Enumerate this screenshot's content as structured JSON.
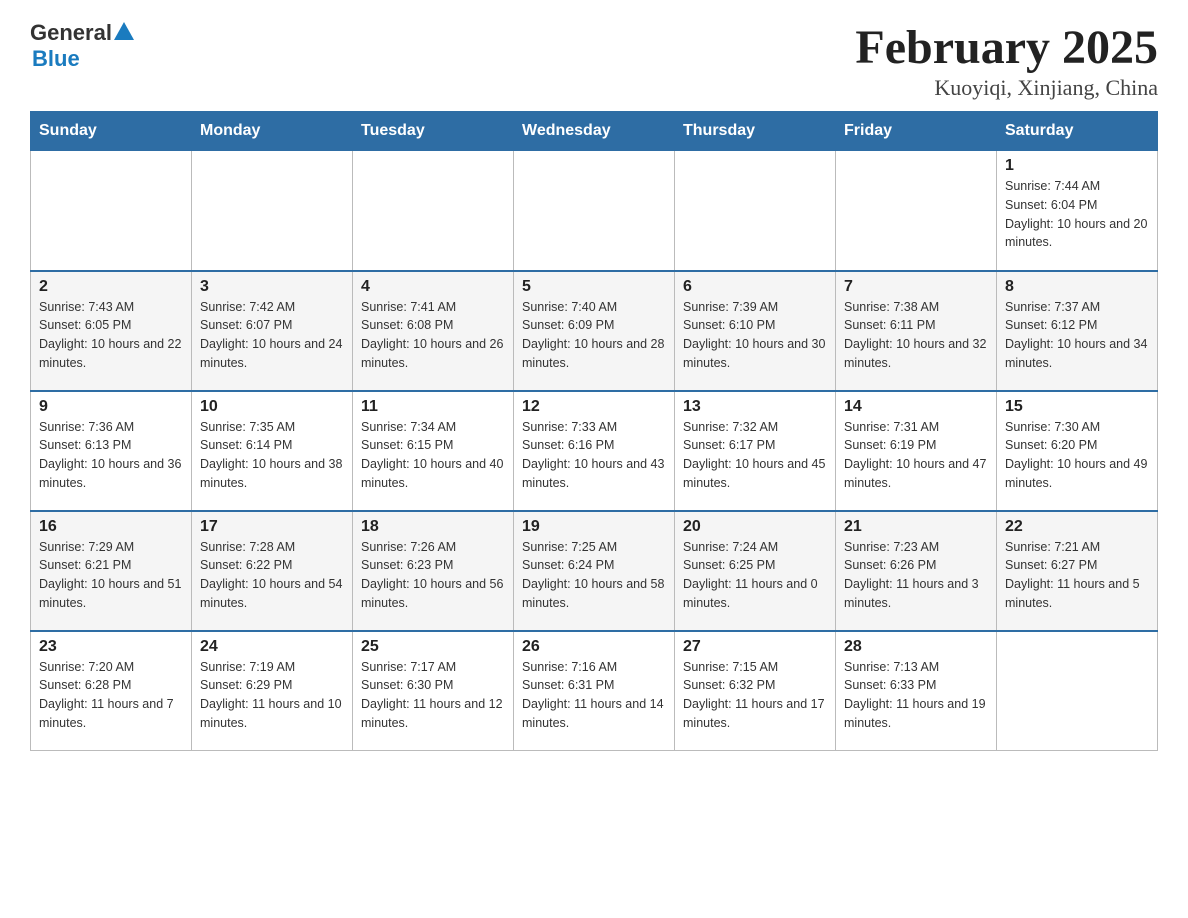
{
  "header": {
    "logo_general": "General",
    "logo_blue": "Blue",
    "title": "February 2025",
    "subtitle": "Kuoyiqi, Xinjiang, China"
  },
  "days_of_week": [
    "Sunday",
    "Monday",
    "Tuesday",
    "Wednesday",
    "Thursday",
    "Friday",
    "Saturday"
  ],
  "weeks": [
    [
      {
        "day": "",
        "info": ""
      },
      {
        "day": "",
        "info": ""
      },
      {
        "day": "",
        "info": ""
      },
      {
        "day": "",
        "info": ""
      },
      {
        "day": "",
        "info": ""
      },
      {
        "day": "",
        "info": ""
      },
      {
        "day": "1",
        "info": "Sunrise: 7:44 AM\nSunset: 6:04 PM\nDaylight: 10 hours and 20 minutes."
      }
    ],
    [
      {
        "day": "2",
        "info": "Sunrise: 7:43 AM\nSunset: 6:05 PM\nDaylight: 10 hours and 22 minutes."
      },
      {
        "day": "3",
        "info": "Sunrise: 7:42 AM\nSunset: 6:07 PM\nDaylight: 10 hours and 24 minutes."
      },
      {
        "day": "4",
        "info": "Sunrise: 7:41 AM\nSunset: 6:08 PM\nDaylight: 10 hours and 26 minutes."
      },
      {
        "day": "5",
        "info": "Sunrise: 7:40 AM\nSunset: 6:09 PM\nDaylight: 10 hours and 28 minutes."
      },
      {
        "day": "6",
        "info": "Sunrise: 7:39 AM\nSunset: 6:10 PM\nDaylight: 10 hours and 30 minutes."
      },
      {
        "day": "7",
        "info": "Sunrise: 7:38 AM\nSunset: 6:11 PM\nDaylight: 10 hours and 32 minutes."
      },
      {
        "day": "8",
        "info": "Sunrise: 7:37 AM\nSunset: 6:12 PM\nDaylight: 10 hours and 34 minutes."
      }
    ],
    [
      {
        "day": "9",
        "info": "Sunrise: 7:36 AM\nSunset: 6:13 PM\nDaylight: 10 hours and 36 minutes."
      },
      {
        "day": "10",
        "info": "Sunrise: 7:35 AM\nSunset: 6:14 PM\nDaylight: 10 hours and 38 minutes."
      },
      {
        "day": "11",
        "info": "Sunrise: 7:34 AM\nSunset: 6:15 PM\nDaylight: 10 hours and 40 minutes."
      },
      {
        "day": "12",
        "info": "Sunrise: 7:33 AM\nSunset: 6:16 PM\nDaylight: 10 hours and 43 minutes."
      },
      {
        "day": "13",
        "info": "Sunrise: 7:32 AM\nSunset: 6:17 PM\nDaylight: 10 hours and 45 minutes."
      },
      {
        "day": "14",
        "info": "Sunrise: 7:31 AM\nSunset: 6:19 PM\nDaylight: 10 hours and 47 minutes."
      },
      {
        "day": "15",
        "info": "Sunrise: 7:30 AM\nSunset: 6:20 PM\nDaylight: 10 hours and 49 minutes."
      }
    ],
    [
      {
        "day": "16",
        "info": "Sunrise: 7:29 AM\nSunset: 6:21 PM\nDaylight: 10 hours and 51 minutes."
      },
      {
        "day": "17",
        "info": "Sunrise: 7:28 AM\nSunset: 6:22 PM\nDaylight: 10 hours and 54 minutes."
      },
      {
        "day": "18",
        "info": "Sunrise: 7:26 AM\nSunset: 6:23 PM\nDaylight: 10 hours and 56 minutes."
      },
      {
        "day": "19",
        "info": "Sunrise: 7:25 AM\nSunset: 6:24 PM\nDaylight: 10 hours and 58 minutes."
      },
      {
        "day": "20",
        "info": "Sunrise: 7:24 AM\nSunset: 6:25 PM\nDaylight: 11 hours and 0 minutes."
      },
      {
        "day": "21",
        "info": "Sunrise: 7:23 AM\nSunset: 6:26 PM\nDaylight: 11 hours and 3 minutes."
      },
      {
        "day": "22",
        "info": "Sunrise: 7:21 AM\nSunset: 6:27 PM\nDaylight: 11 hours and 5 minutes."
      }
    ],
    [
      {
        "day": "23",
        "info": "Sunrise: 7:20 AM\nSunset: 6:28 PM\nDaylight: 11 hours and 7 minutes."
      },
      {
        "day": "24",
        "info": "Sunrise: 7:19 AM\nSunset: 6:29 PM\nDaylight: 11 hours and 10 minutes."
      },
      {
        "day": "25",
        "info": "Sunrise: 7:17 AM\nSunset: 6:30 PM\nDaylight: 11 hours and 12 minutes."
      },
      {
        "day": "26",
        "info": "Sunrise: 7:16 AM\nSunset: 6:31 PM\nDaylight: 11 hours and 14 minutes."
      },
      {
        "day": "27",
        "info": "Sunrise: 7:15 AM\nSunset: 6:32 PM\nDaylight: 11 hours and 17 minutes."
      },
      {
        "day": "28",
        "info": "Sunrise: 7:13 AM\nSunset: 6:33 PM\nDaylight: 11 hours and 19 minutes."
      },
      {
        "day": "",
        "info": ""
      }
    ]
  ]
}
